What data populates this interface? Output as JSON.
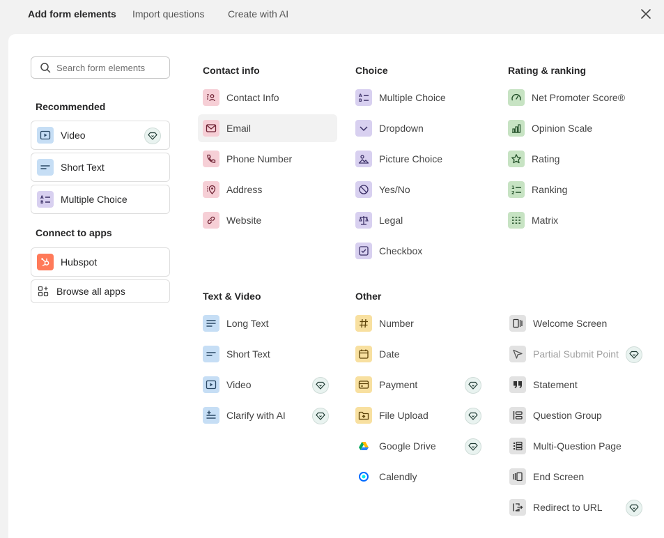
{
  "tabs": [
    "Add form elements",
    "Import questions",
    "Create with AI"
  ],
  "search": {
    "placeholder": "Search form elements"
  },
  "sidebar": {
    "recommended_heading": "Recommended",
    "recommended": [
      {
        "label": "Video",
        "icon": "video-icon",
        "pro": true
      },
      {
        "label": "Short Text",
        "icon": "short-text-icon",
        "pro": false
      },
      {
        "label": "Multiple Choice",
        "icon": "multiple-choice-icon",
        "pro": false
      }
    ],
    "apps_heading": "Connect to apps",
    "apps": [
      {
        "label": "Hubspot",
        "icon": "hubspot-icon"
      },
      {
        "label": "Browse all apps",
        "icon": "grid-plus-icon"
      }
    ]
  },
  "sections": {
    "contact": {
      "heading": "Contact info",
      "items": [
        "Contact Info",
        "Email",
        "Phone Number",
        "Address",
        "Website"
      ]
    },
    "choice": {
      "heading": "Choice",
      "items": [
        "Multiple Choice",
        "Dropdown",
        "Picture Choice",
        "Yes/No",
        "Legal",
        "Checkbox"
      ]
    },
    "rating": {
      "heading": "Rating & ranking",
      "items": [
        "Net Promoter Score®",
        "Opinion Scale",
        "Rating",
        "Ranking",
        "Matrix"
      ]
    },
    "text_video": {
      "heading": "Text & Video",
      "items": [
        "Long Text",
        "Short Text",
        "Video",
        "Clarify with AI"
      ]
    },
    "other": {
      "heading": "Other",
      "items": [
        "Number",
        "Date",
        "Payment",
        "File Upload",
        "Google Drive",
        "Calendly"
      ]
    },
    "screens": {
      "items": [
        "Welcome Screen",
        "Partial Submit Point",
        "Statement",
        "Question Group",
        "Multi-Question Page",
        "End Screen",
        "Redirect to URL"
      ]
    }
  },
  "colors": {
    "pink": "#f6cfd6",
    "purple": "#d8d0f0",
    "green": "#c7e3c3",
    "blue": "#c6def5",
    "yellow": "#f8e0a0",
    "gray": "#e2e2e2",
    "hubspot": "#ff7a59"
  }
}
